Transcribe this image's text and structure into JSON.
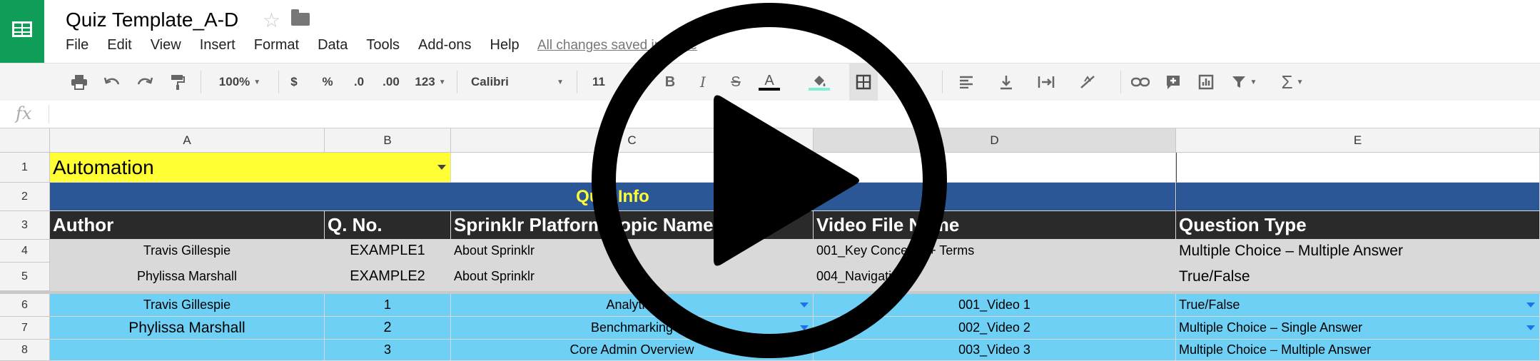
{
  "window": {
    "doc_title": "Quiz Template_A-D",
    "menu": [
      "File",
      "Edit",
      "View",
      "Insert",
      "Format",
      "Data",
      "Tools",
      "Add-ons",
      "Help"
    ],
    "saved_status": "All changes saved in Drive"
  },
  "toolbar": {
    "zoom": "100%",
    "currency": "$",
    "percent": "%",
    "dec_less": ".0",
    "dec_more": ".00",
    "number_format": "123",
    "font": "Calibri",
    "font_size": "11",
    "bold": "B",
    "italic": "I",
    "strike": "S",
    "text_color": "A"
  },
  "formula_bar": {
    "fx_label": "fx",
    "value": ""
  },
  "columns": [
    "A",
    "B",
    "C",
    "D",
    "E"
  ],
  "rows": [
    "1",
    "2",
    "3",
    "4",
    "5",
    "6",
    "7",
    "8"
  ],
  "sheet": {
    "a1": "Automation",
    "quiz_info": "Quiz Info",
    "headers": [
      "Author",
      "Q. No.",
      "Sprinklr Platform Topic Name",
      "Video File Name",
      "Question Type"
    ],
    "examples": [
      [
        "Travis Gillespie",
        "EXAMPLE1",
        "About Sprinklr",
        "001_Key Concepts + Terms",
        "Multiple Choice – Multiple Answer"
      ],
      [
        "Phylissa Marshall",
        "EXAMPLE2",
        "About Sprinklr",
        "004_Navigation",
        "True/False"
      ]
    ],
    "data_rows": [
      [
        "Travis Gillespie",
        "1",
        "Analytics",
        "001_Video 1",
        "True/False"
      ],
      [
        "Phylissa Marshall",
        "2",
        "Benchmarking",
        "002_Video 2",
        "Multiple Choice – Single Answer"
      ],
      [
        "",
        "3",
        "Core Admin Overview",
        "003_Video 3",
        "Multiple Choice – Multiple Answer"
      ]
    ]
  },
  "colors": {
    "brand_green": "#0f9d58",
    "yellow": "#ffff33",
    "blue_banner": "#2b5797",
    "header_dark": "#2a2a2a",
    "example_gray": "#d9d9d9",
    "data_cyan": "#6fd0f6",
    "quiz_info_text": "#ffff33"
  },
  "overlay": {
    "icon": "play-button-icon"
  }
}
